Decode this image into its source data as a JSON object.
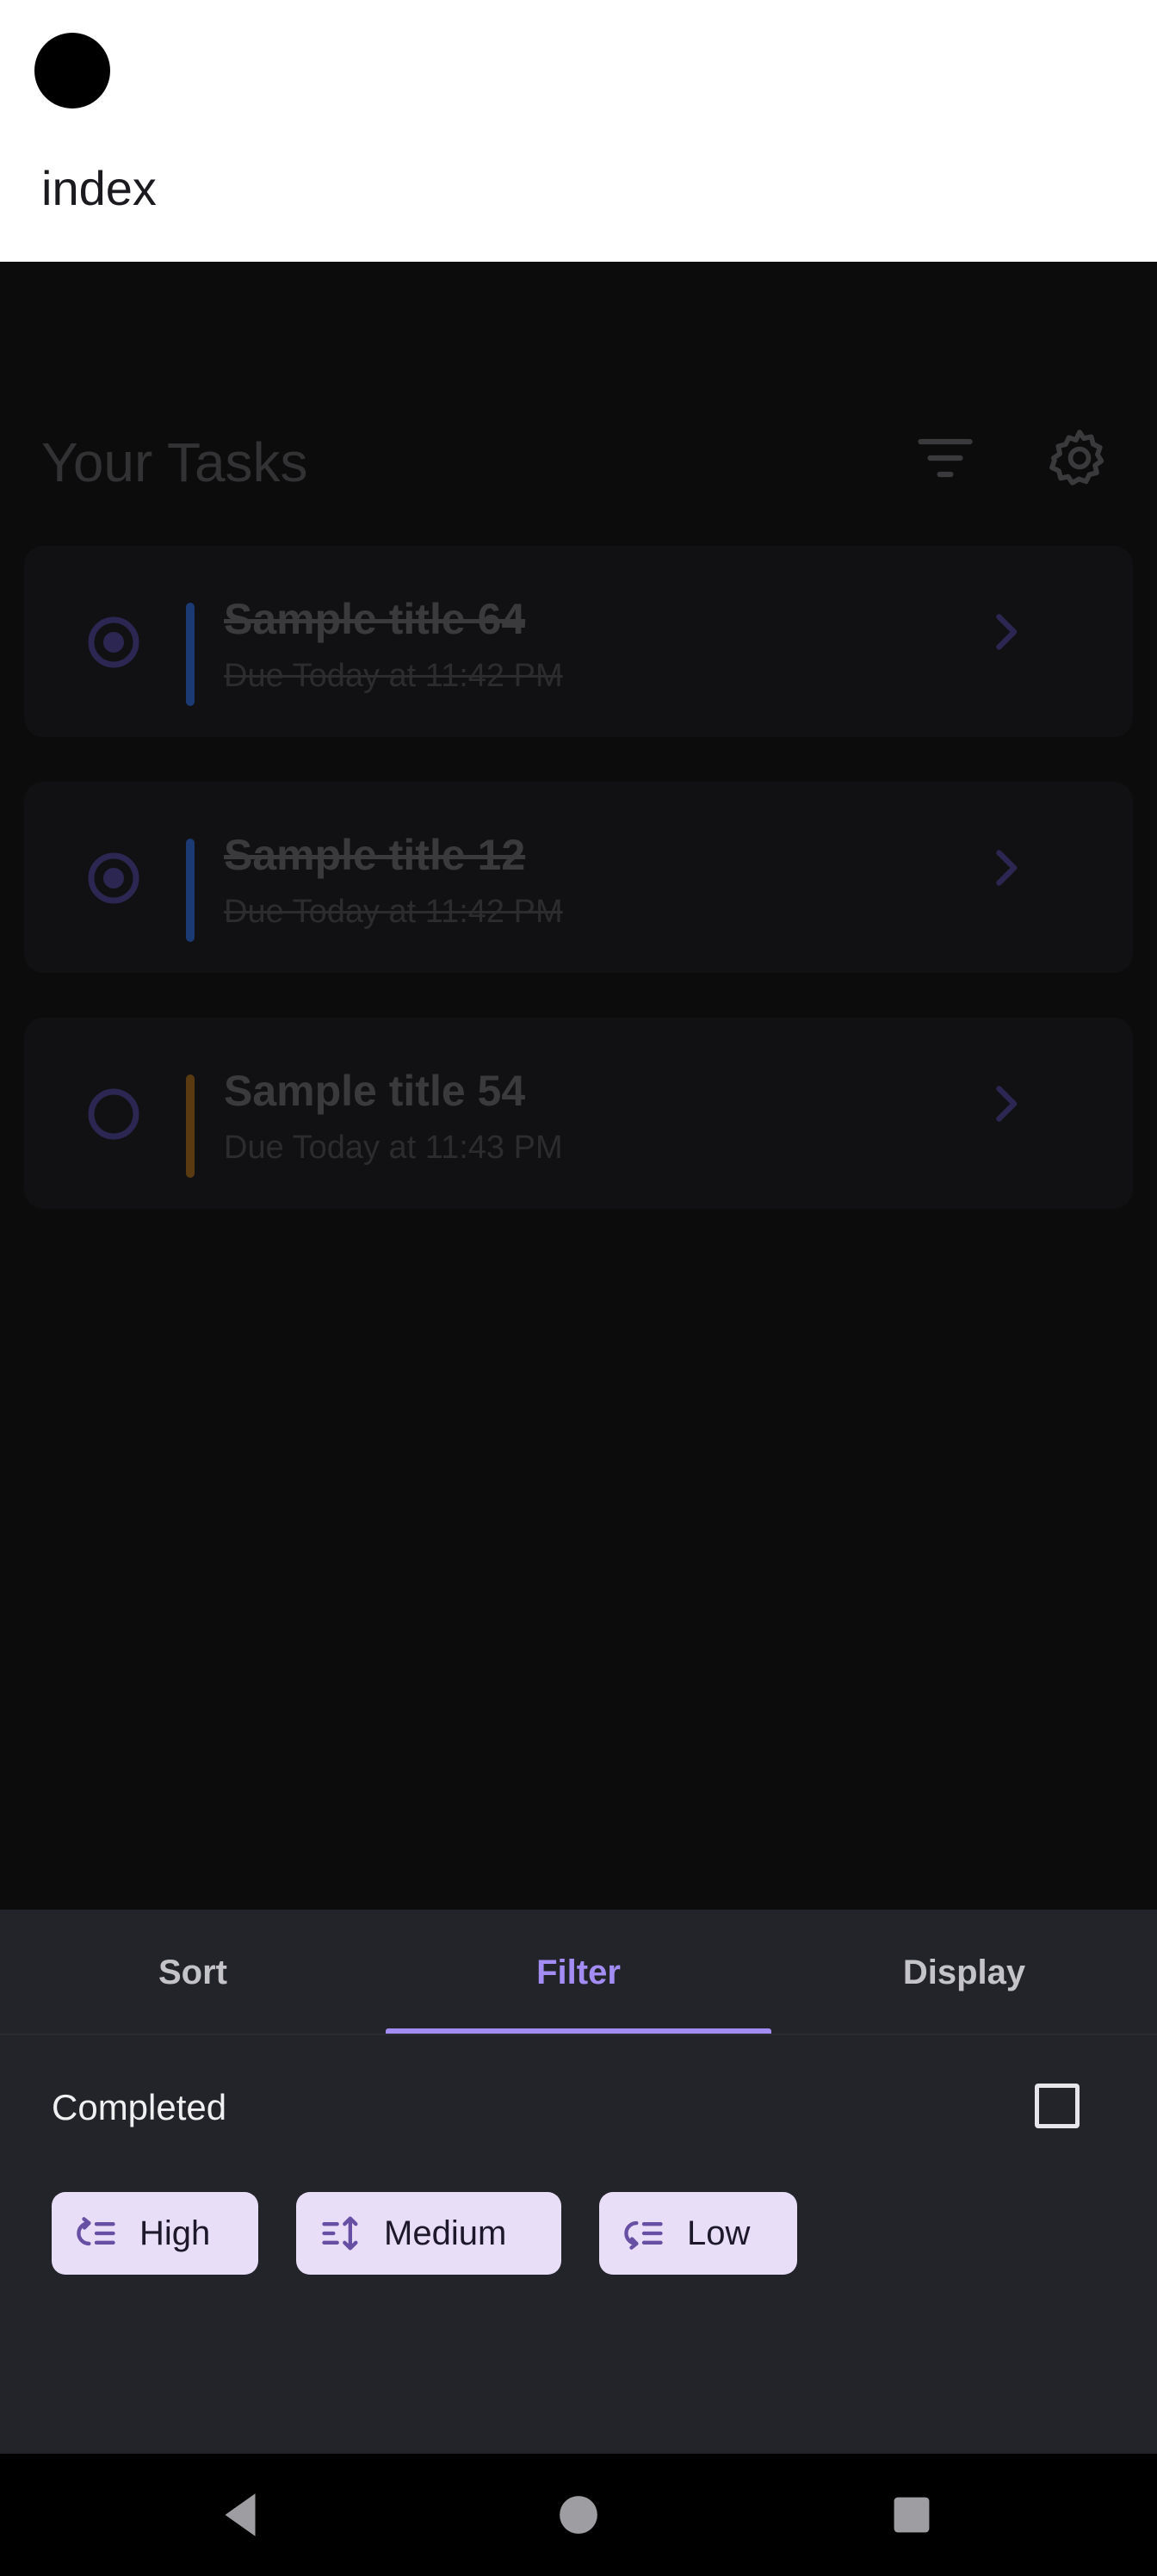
{
  "header": {
    "route_title": "index"
  },
  "tasks_screen": {
    "title": "Your Tasks",
    "filter_icon": "filter-list-icon",
    "settings_icon": "gear-icon",
    "tasks": [
      {
        "title": "Sample title 64",
        "due": "Due Today at 11:42 PM",
        "completed": true,
        "priority_color": "#1b3a73"
      },
      {
        "title": "Sample title 12",
        "due": "Due Today at 11:42 PM",
        "completed": true,
        "priority_color": "#1b3a73"
      },
      {
        "title": "Sample title 54",
        "due": "Due Today at 11:43 PM",
        "completed": false,
        "priority_color": "#5a3a10"
      }
    ]
  },
  "sheet": {
    "tabs": [
      {
        "label": "Sort",
        "active": false
      },
      {
        "label": "Filter",
        "active": true
      },
      {
        "label": "Display",
        "active": false
      }
    ],
    "completed_label": "Completed",
    "completed_checked": false,
    "chips": [
      {
        "label": "High",
        "icon": "priority-high-icon"
      },
      {
        "label": "Medium",
        "icon": "priority-medium-icon"
      },
      {
        "label": "Low",
        "icon": "priority-low-icon"
      }
    ]
  },
  "nav": {
    "back_icon": "back-icon",
    "home_icon": "home-icon",
    "recents_icon": "recents-icon"
  },
  "colors": {
    "accent": "#a38cf4",
    "chip_bg": "#e8def8",
    "sheet_bg": "#232429"
  }
}
